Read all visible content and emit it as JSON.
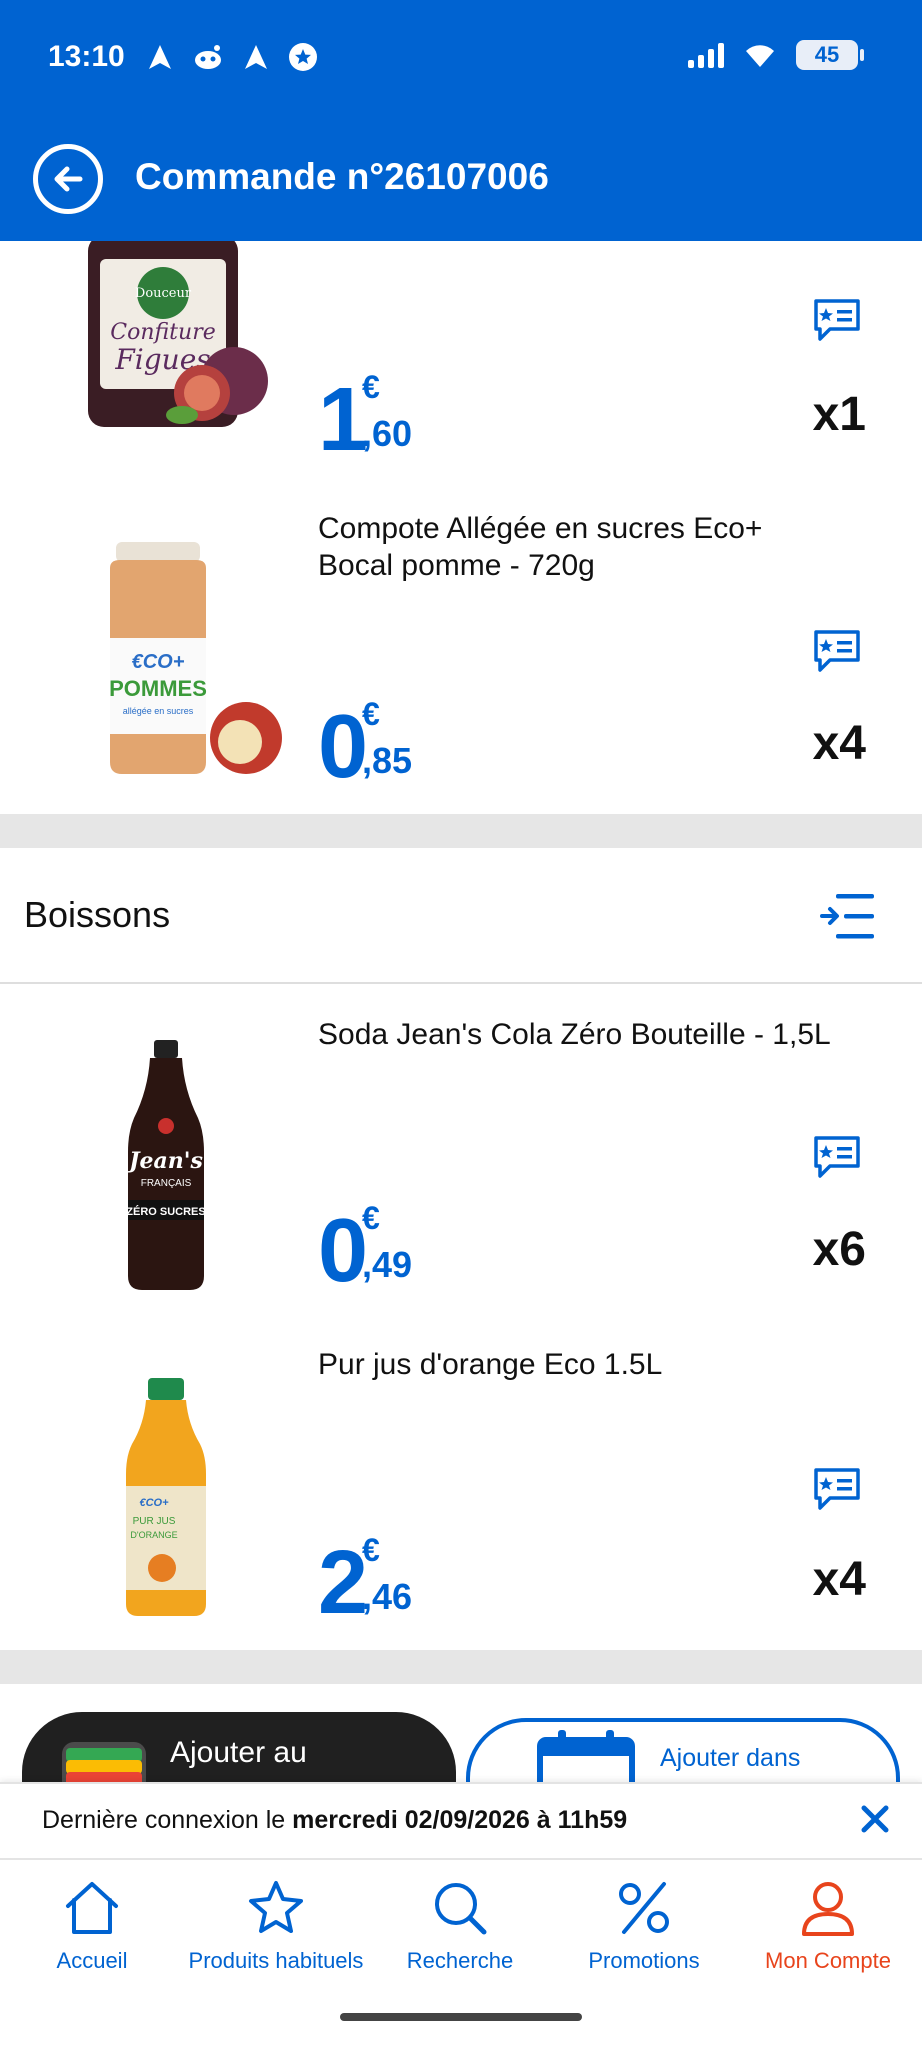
{
  "status_bar": {
    "time": "13:10",
    "battery": "45"
  },
  "header": {
    "title": "Commande n°26107006"
  },
  "products_top": [
    {
      "name": "",
      "price_int": "1",
      "price_cur": "€",
      "price_dec": ",60",
      "qty": "x1",
      "image": "confiture-figues-jar"
    },
    {
      "name": "Compote Allégée en sucres Eco+ Bocal pomme - 720g",
      "price_int": "0",
      "price_cur": "€",
      "price_dec": ",85",
      "qty": "x4",
      "image": "compote-pommes-jar"
    }
  ],
  "section": {
    "title": "Boissons"
  },
  "products_boissons": [
    {
      "name": "Soda Jean's Cola Zéro Bouteille - 1,5L",
      "price_int": "0",
      "price_cur": "€",
      "price_dec": ",49",
      "qty": "x6",
      "image": "cola-bottle"
    },
    {
      "name": "Pur jus d'orange Eco 1.5L",
      "price_int": "2",
      "price_cur": "€",
      "price_dec": ",46",
      "qty": "x4",
      "image": "orange-juice-bottle"
    }
  ],
  "actions": {
    "wallet_label": "Ajouter au",
    "calendar_label": "Ajouter dans"
  },
  "banner": {
    "prefix": "Dernière connexion le ",
    "date": "mercredi 02/09/2026 à 11h59"
  },
  "nav": [
    {
      "label": "Accueil",
      "icon": "home-icon"
    },
    {
      "label": "Produits habituels",
      "icon": "star-icon"
    },
    {
      "label": "Recherche",
      "icon": "search-icon"
    },
    {
      "label": "Promotions",
      "icon": "percent-icon"
    },
    {
      "label": "Mon Compte",
      "icon": "account-icon"
    }
  ],
  "colors": {
    "brand": "#0063d1",
    "active": "#e8441c"
  }
}
